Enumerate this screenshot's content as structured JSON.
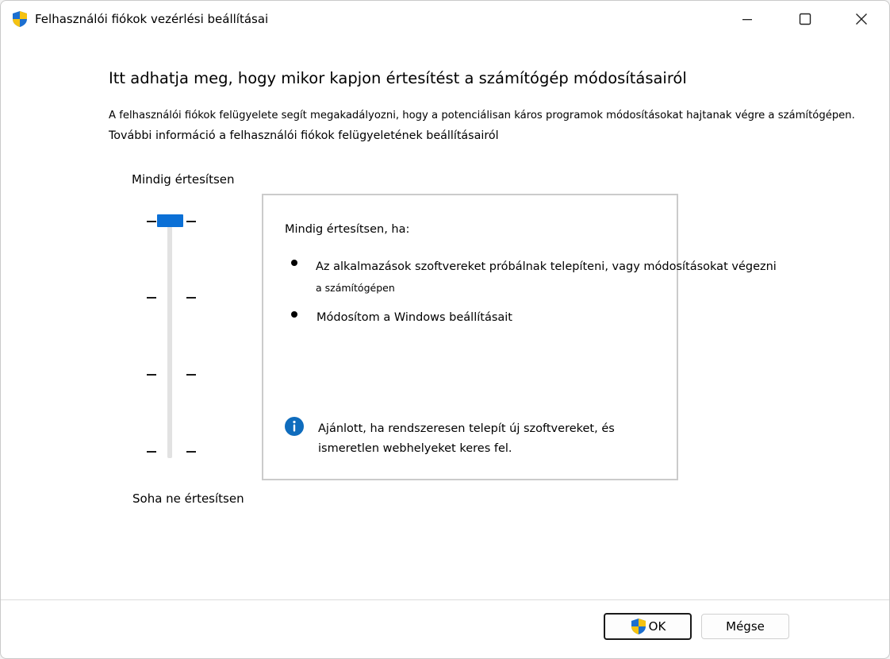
{
  "window": {
    "title": "Felhasználói fiókok vezérlési beállításai"
  },
  "content": {
    "heading": "Itt adhatja meg, hogy mikor kapjon értesítést a számítógép módosításairól",
    "description": "A felhasználói fiókok felügyelete segít megakadályozni, hogy a potenciálisan káros programok módosításokat hajtanak végre a számítógépen.",
    "more_info_link": "További információ a felhasználói fiókok felügyeletének beállításairól"
  },
  "slider": {
    "top_label": "Mindig értesítsen",
    "bottom_label": "Soha ne értesítsen",
    "levels": 4,
    "selected_level": 4
  },
  "info_panel": {
    "heading": "Mindig értesítsen, ha:",
    "bullets": [
      {
        "line1": "Az alkalmazások szoftvereket próbálnak telepíteni, vagy módosításokat végezni",
        "line2": "a számítógépen"
      },
      {
        "line1": "Módosítom a Windows beállításait"
      }
    ],
    "recommendation": {
      "line1": "Ajánlott, ha rendszeresen telepít új szoftvereket, és",
      "line2": "ismeretlen webhelyeket keres fel."
    }
  },
  "buttons": {
    "ok": "OK",
    "cancel": "Mégse"
  },
  "colors": {
    "accent": "#0b70d6",
    "info_icon": "#0f6cbd",
    "shield_blue": "#1c6fd0",
    "shield_yellow": "#f5c211"
  },
  "icons": {
    "title": "uac-shield-icon",
    "minimize": "minimize-icon",
    "maximize": "maximize-icon",
    "close": "close-icon",
    "info": "info-icon",
    "ok": "uac-shield-icon"
  }
}
